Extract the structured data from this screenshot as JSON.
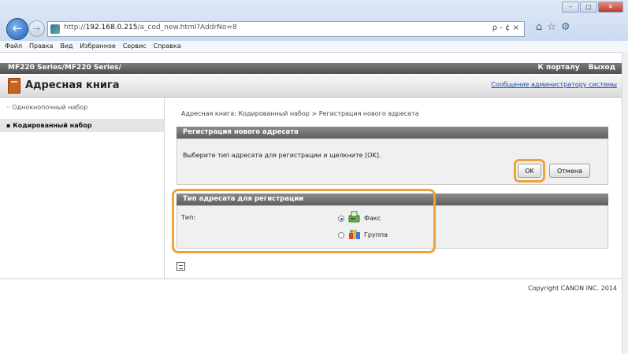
{
  "browser": {
    "url_prefix": "http://",
    "url_host": "192.168.0.215",
    "url_path": "/a_cod_new.html?AddrNo=8",
    "addr_controls": "ρ - ¢ ×",
    "menu": [
      "Файл",
      "Правка",
      "Вид",
      "Избранное",
      "Сервис",
      "Справка"
    ]
  },
  "topbar": {
    "device": "MF220 Series/MF220 Series/",
    "portal_link": "К порталу",
    "logout_link": "Выход"
  },
  "header": {
    "title": "Адресная книга",
    "admin_link": "Сообщение администратору системы"
  },
  "sidebar": {
    "items": [
      {
        "label": "Однокнопочный набор"
      },
      {
        "label": "Кодированный набор"
      }
    ]
  },
  "main": {
    "breadcrumb": "Адресная книга: Кодированный набор > Регистрация нового адресата",
    "section_title": "Регистрация нового адресата",
    "instruction": "Выберите тип адресата для регистрации и щелкните [OK].",
    "ok_label": "OK",
    "cancel_label": "Отмена",
    "type_section_title": "Тип адресата для регистрации",
    "type_label": "Тип:",
    "options": [
      {
        "label": "Факс",
        "icon": "fax-icon",
        "selected": true
      },
      {
        "label": "Группа",
        "icon": "group-icon",
        "selected": false
      }
    ]
  },
  "footer": {
    "copyright": "Copyright CANON INC. 2014"
  },
  "colors": {
    "highlight": "#f0a23a",
    "link": "#1e4ea8",
    "header_bar": "#5a5a5a"
  }
}
